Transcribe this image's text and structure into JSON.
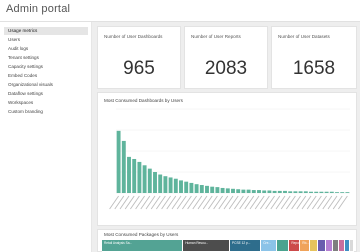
{
  "app": {
    "title": "Admin portal"
  },
  "sidebar": {
    "items": [
      {
        "label": "Usage metrics",
        "active": true
      },
      {
        "label": "Users"
      },
      {
        "label": "Audit logs"
      },
      {
        "label": "Tenant settings"
      },
      {
        "label": "Capacity settings"
      },
      {
        "label": "Embed Codes"
      },
      {
        "label": "Organizational visuals"
      },
      {
        "label": "Dataflow settings"
      },
      {
        "label": "Workspaces"
      },
      {
        "label": "Custom branding"
      }
    ]
  },
  "kpis": [
    {
      "label": "Number of User Dashboards",
      "value": "965"
    },
    {
      "label": "Number of User Reports",
      "value": "2083"
    },
    {
      "label": "Number of User Datasets",
      "value": "1658"
    }
  ],
  "colors": {
    "bar": "#5fb49c",
    "accent": "#3a9a8a",
    "gridline": "#eeeeee"
  },
  "chart_data": [
    {
      "type": "bar",
      "title": "Most Consumed Dashboards by Users",
      "ylim": [
        0,
        200
      ],
      "values": [
        148,
        124,
        86,
        81,
        74,
        66,
        58,
        50,
        44,
        40,
        37,
        34,
        30,
        27,
        24,
        21,
        19,
        17,
        15,
        14,
        12,
        11,
        10,
        9,
        8,
        8,
        7,
        7,
        6,
        6,
        5,
        5,
        5,
        4,
        4,
        4,
        4,
        3,
        3,
        3,
        3,
        3,
        2,
        2,
        2
      ]
    },
    {
      "type": "heatmap",
      "title": "Most Consumed Packages by Users",
      "tiles": [
        {
          "label": "Retail Analysis Sa...",
          "value": 260,
          "color": "#53a394"
        },
        {
          "label": "Human Resou...",
          "value": 150,
          "color": "#4d4d4d"
        },
        {
          "label": "PCSE 12 p...",
          "value": 100,
          "color": "#2e6d8c"
        },
        {
          "label": "Cre...",
          "value": 50,
          "color": "#8bc3e8"
        },
        {
          "label": "",
          "value": 40,
          "color": "#4aa38f"
        },
        {
          "label": "Repo...",
          "value": 35,
          "color": "#cc4a4a"
        },
        {
          "label": "Rb...",
          "value": 30,
          "color": "#f0a35a"
        },
        {
          "label": "",
          "value": 28,
          "color": "#e6c35c"
        },
        {
          "label": "",
          "value": 24,
          "color": "#6a5cae"
        },
        {
          "label": "",
          "value": 22,
          "color": "#b57fd3"
        },
        {
          "label": "",
          "value": 20,
          "color": "#7f7f7f"
        },
        {
          "label": "",
          "value": 18,
          "color": "#c86e9e"
        },
        {
          "label": "",
          "value": 16,
          "color": "#3f8fc4"
        },
        {
          "label": "",
          "value": 14,
          "color": "#d9d9d9"
        }
      ]
    }
  ]
}
